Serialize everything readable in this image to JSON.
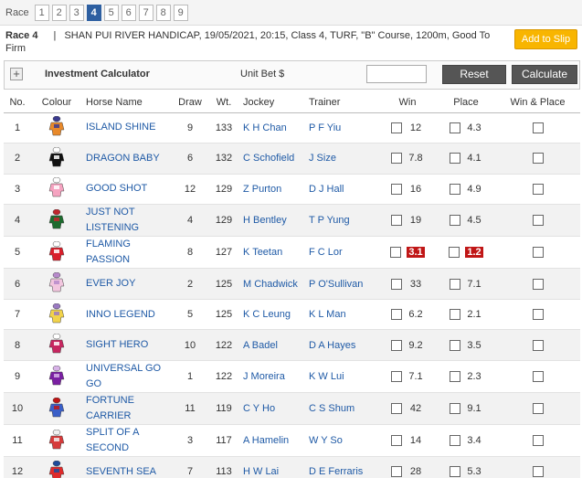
{
  "race_bar": {
    "label": "Race",
    "races": [
      "1",
      "2",
      "3",
      "4",
      "5",
      "6",
      "7",
      "8",
      "9"
    ],
    "active_index": 3
  },
  "race_info": {
    "race_title": "Race 4",
    "details": "SHAN PUI RIVER HANDICAP, 19/05/2021, 20:15, Class 4, TURF, \"B\" Course, 1200m, Good To Firm"
  },
  "add_to_slip_label": "Add to Slip",
  "calculator": {
    "toggle_symbol": "+",
    "title": "Investment Calculator",
    "unit_bet_label": "Unit Bet $",
    "reset_label": "Reset",
    "calculate_label": "Calculate"
  },
  "table": {
    "headers": [
      "No.",
      "Colour",
      "Horse Name",
      "Draw",
      "Wt.",
      "Jockey",
      "Trainer",
      "Win",
      "Place",
      "Win & Place"
    ],
    "rows": [
      {
        "no": "1",
        "horse": "ISLAND SHINE",
        "draw": "9",
        "wt": "133",
        "jockey": "K H Chan",
        "trainer": "P F Yiu",
        "win": "12",
        "place": "4.3",
        "win_hot": false,
        "place_hot": false
      },
      {
        "no": "2",
        "horse": "DRAGON BABY",
        "draw": "6",
        "wt": "132",
        "jockey": "C Schofield",
        "trainer": "J Size",
        "win": "7.8",
        "place": "4.1",
        "win_hot": false,
        "place_hot": false
      },
      {
        "no": "3",
        "horse": "GOOD SHOT",
        "draw": "12",
        "wt": "129",
        "jockey": "Z Purton",
        "trainer": "D J Hall",
        "win": "16",
        "place": "4.9",
        "win_hot": false,
        "place_hot": false
      },
      {
        "no": "4",
        "horse": "JUST NOT LISTENING",
        "draw": "4",
        "wt": "129",
        "jockey": "H Bentley",
        "trainer": "T P Yung",
        "win": "19",
        "place": "4.5",
        "win_hot": false,
        "place_hot": false
      },
      {
        "no": "5",
        "horse": "FLAMING PASSION",
        "draw": "8",
        "wt": "127",
        "jockey": "K Teetan",
        "trainer": "F C Lor",
        "win": "3.1",
        "place": "1.2",
        "win_hot": true,
        "place_hot": true
      },
      {
        "no": "6",
        "horse": "EVER JOY",
        "draw": "2",
        "wt": "125",
        "jockey": "M Chadwick",
        "trainer": "P O'Sullivan",
        "win": "33",
        "place": "7.1",
        "win_hot": false,
        "place_hot": false
      },
      {
        "no": "7",
        "horse": "INNO LEGEND",
        "draw": "5",
        "wt": "125",
        "jockey": "K C Leung",
        "trainer": "K L Man",
        "win": "6.2",
        "place": "2.1",
        "win_hot": false,
        "place_hot": false
      },
      {
        "no": "8",
        "horse": "SIGHT HERO",
        "draw": "10",
        "wt": "122",
        "jockey": "A Badel",
        "trainer": "D A Hayes",
        "win": "9.2",
        "place": "3.5",
        "win_hot": false,
        "place_hot": false
      },
      {
        "no": "9",
        "horse": "UNIVERSAL GO GO",
        "draw": "1",
        "wt": "122",
        "jockey": "J Moreira",
        "trainer": "K W Lui",
        "win": "7.1",
        "place": "2.3",
        "win_hot": false,
        "place_hot": false
      },
      {
        "no": "10",
        "horse": "FORTUNE CARRIER",
        "draw": "11",
        "wt": "119",
        "jockey": "C Y Ho",
        "trainer": "C S Shum",
        "win": "42",
        "place": "9.1",
        "win_hot": false,
        "place_hot": false
      },
      {
        "no": "11",
        "horse": "SPLIT OF A SECOND",
        "draw": "3",
        "wt": "117",
        "jockey": "A Hamelin",
        "trainer": "W Y So",
        "win": "14",
        "place": "3.4",
        "win_hot": false,
        "place_hot": false
      },
      {
        "no": "12",
        "horse": "SEVENTH SEA",
        "draw": "7",
        "wt": "113",
        "jockey": "H W Lai",
        "trainer": "D E Ferraris",
        "win": "28",
        "place": "5.3",
        "win_hot": false,
        "place_hot": false
      }
    ]
  },
  "silk_colors": [
    [
      "#e8892a",
      "#3b3b8f"
    ],
    [
      "#111111",
      "#ffffff"
    ],
    [
      "#f5a3c0",
      "#ffffff"
    ],
    [
      "#1d6b2e",
      "#c0262d"
    ],
    [
      "#d91e2a",
      "#ffffff"
    ],
    [
      "#f2c6df",
      "#b78acb"
    ],
    [
      "#f2d34a",
      "#9a7ac2"
    ],
    [
      "#c72660",
      "#ffffff"
    ],
    [
      "#7a1fa2",
      "#d8b3e8"
    ],
    [
      "#3a5fc8",
      "#c01616"
    ],
    [
      "#d63a3a",
      "#f0f0f0"
    ],
    [
      "#e02a2a",
      "#1d4b9a"
    ]
  ],
  "colors": {
    "active_race": "#2d5fa1",
    "add_to_slip": "#f8b500",
    "hot_odds": "#c01616",
    "link": "#1f5aa6"
  }
}
